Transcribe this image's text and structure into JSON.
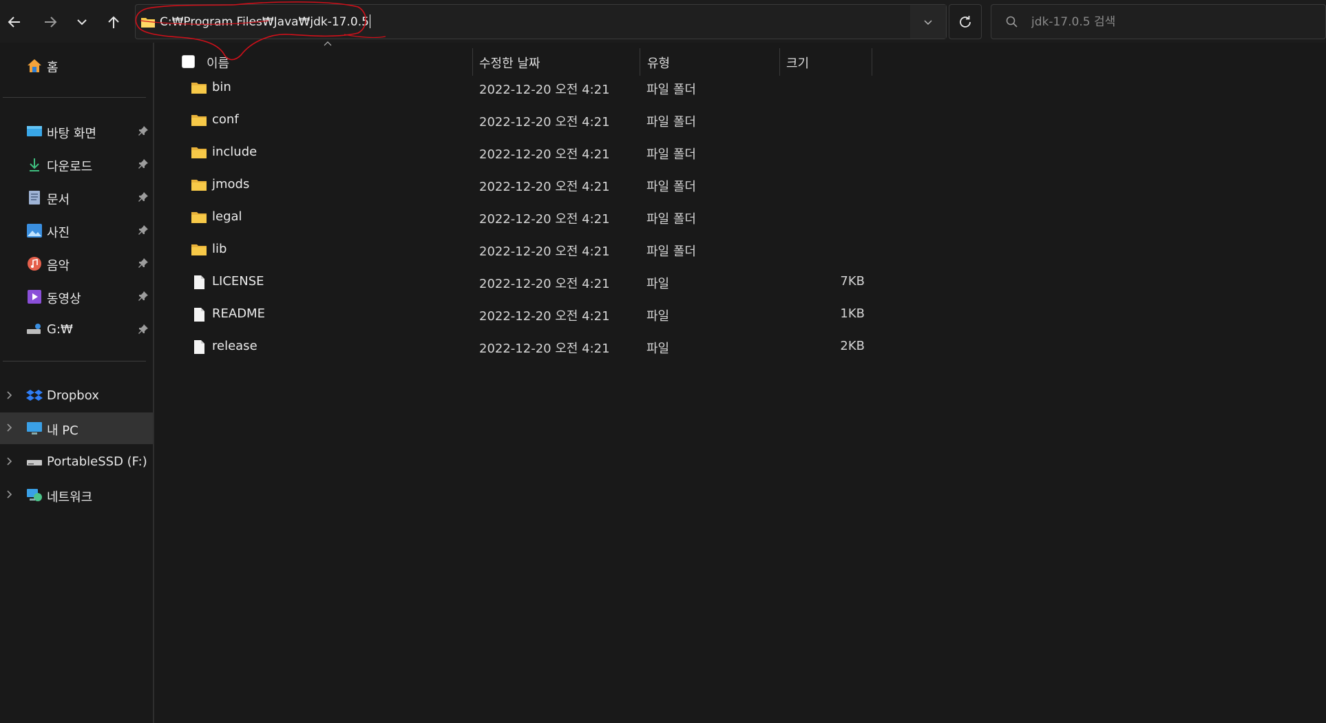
{
  "address_bar": {
    "path": "C:₩Program Files₩Java₩jdk-17.0.5"
  },
  "search": {
    "placeholder": "jdk-17.0.5 검색"
  },
  "sidebar": {
    "home": "홈",
    "pinned": [
      {
        "label": "바탕 화면",
        "icon": "desktop-icon"
      },
      {
        "label": "다운로드",
        "icon": "download-icon"
      },
      {
        "label": "문서",
        "icon": "documents-icon"
      },
      {
        "label": "사진",
        "icon": "pictures-icon"
      },
      {
        "label": "음악",
        "icon": "music-icon"
      },
      {
        "label": "동영상",
        "icon": "videos-icon"
      },
      {
        "label": "G:₩",
        "icon": "network-drive-icon"
      }
    ],
    "locations": [
      {
        "label": "Dropbox",
        "icon": "dropbox-icon"
      },
      {
        "label": "내 PC",
        "icon": "pc-icon",
        "selected": true
      },
      {
        "label": "PortableSSD (F:)",
        "icon": "drive-icon"
      },
      {
        "label": "네트워크",
        "icon": "network-icon"
      }
    ]
  },
  "columns": {
    "name": "이름",
    "modified": "수정한 날짜",
    "type": "유형",
    "size": "크기"
  },
  "files": [
    {
      "name": "bin",
      "modified": "2022-12-20 오전 4:21",
      "type": "파일 폴더",
      "size": "",
      "kind": "folder"
    },
    {
      "name": "conf",
      "modified": "2022-12-20 오전 4:21",
      "type": "파일 폴더",
      "size": "",
      "kind": "folder"
    },
    {
      "name": "include",
      "modified": "2022-12-20 오전 4:21",
      "type": "파일 폴더",
      "size": "",
      "kind": "folder"
    },
    {
      "name": "jmods",
      "modified": "2022-12-20 오전 4:21",
      "type": "파일 폴더",
      "size": "",
      "kind": "folder"
    },
    {
      "name": "legal",
      "modified": "2022-12-20 오전 4:21",
      "type": "파일 폴더",
      "size": "",
      "kind": "folder"
    },
    {
      "name": "lib",
      "modified": "2022-12-20 오전 4:21",
      "type": "파일 폴더",
      "size": "",
      "kind": "folder"
    },
    {
      "name": "LICENSE",
      "modified": "2022-12-20 오전 4:21",
      "type": "파일",
      "size": "7KB",
      "kind": "file"
    },
    {
      "name": "README",
      "modified": "2022-12-20 오전 4:21",
      "type": "파일",
      "size": "1KB",
      "kind": "file"
    },
    {
      "name": "release",
      "modified": "2022-12-20 오전 4:21",
      "type": "파일",
      "size": "2KB",
      "kind": "file"
    }
  ],
  "colors": {
    "folder": "#f7c948",
    "annotation": "#d0101a",
    "background": "#191919"
  }
}
